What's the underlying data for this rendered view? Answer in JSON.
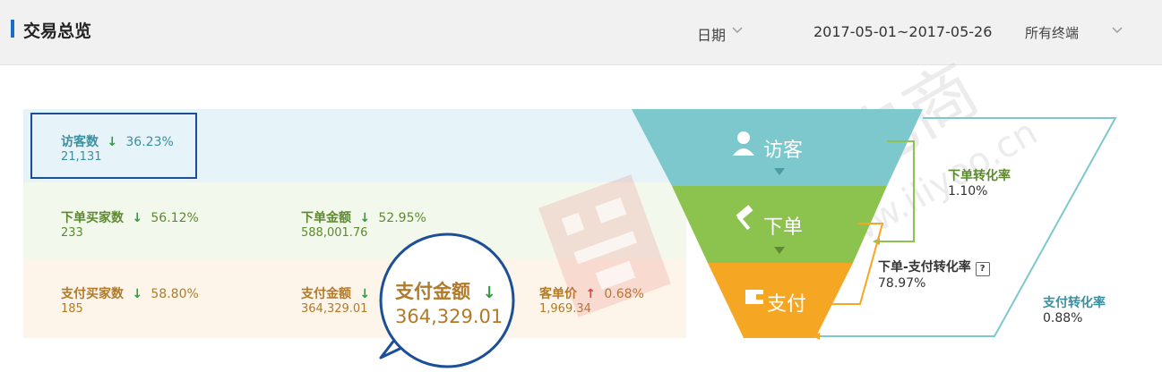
{
  "header": {
    "title": "交易总览",
    "date_label": "日期",
    "date_range": "2017-05-01~2017-05-26",
    "terminal_label": "所有终端"
  },
  "rows": {
    "visitors": {
      "label": "访客数",
      "change": "36.23%",
      "value": "21,131",
      "trend": "down"
    },
    "order_buyers": {
      "label": "下单买家数",
      "change": "56.12%",
      "value": "233",
      "trend": "down"
    },
    "order_amount": {
      "label": "下单金额",
      "change": "52.95%",
      "value": "588,001.76",
      "trend": "down"
    },
    "pay_buyers": {
      "label": "支付买家数",
      "change": "58.80%",
      "value": "185",
      "trend": "down"
    },
    "pay_amount": {
      "label": "支付金额",
      "value": "364,329.01",
      "trend": "down"
    },
    "avg_price": {
      "label": "客单价",
      "change": "0.68%",
      "value": "1,969.34",
      "trend": "up"
    }
  },
  "callout": {
    "label": "支付金额",
    "value": "364,329.01"
  },
  "funnel": {
    "stage1": "访客",
    "stage2": "下单",
    "stage3": "支付"
  },
  "conversions": {
    "order_rate": {
      "label": "下单转化率",
      "value": "1.10%"
    },
    "order_pay_rate": {
      "label": "下单-支付转化率",
      "value": "78.97%"
    },
    "pay_rate": {
      "label": "支付转化率",
      "value": "0.88%"
    }
  },
  "watermark": {
    "text": "简图电商",
    "url": "www.iiiyoo.cn"
  },
  "colors": {
    "stage1": "#7cc8cc",
    "stage2": "#8cc34f",
    "stage3": "#f5a623",
    "accent": "#1d4f96"
  }
}
